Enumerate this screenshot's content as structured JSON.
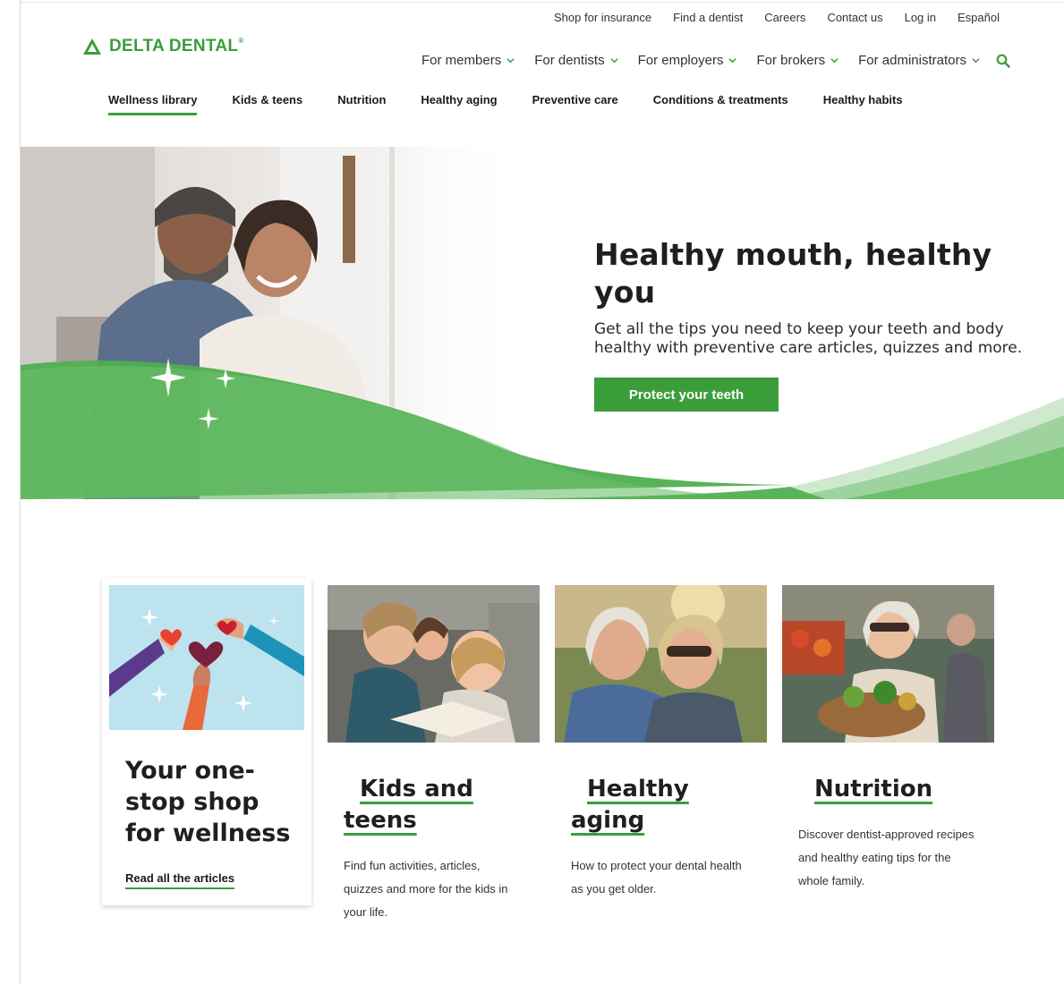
{
  "brand": {
    "name": "DELTA DENTAL",
    "accent": "#3a9d3a",
    "logo_icon": "delta-triangle-icon"
  },
  "utility_nav": [
    "Shop for insurance",
    "Find a dentist",
    "Careers",
    "Contact us",
    "Log in",
    "Español"
  ],
  "main_nav": {
    "items": [
      "For members",
      "For dentists",
      "For employers",
      "For brokers",
      "For administrators"
    ],
    "search_icon": "search-icon"
  },
  "sub_nav": {
    "items": [
      "Wellness library",
      "Kids & teens",
      "Nutrition",
      "Healthy aging",
      "Preventive care",
      "Conditions & treatments",
      "Healthy habits"
    ],
    "active": "Wellness library"
  },
  "hero": {
    "title": "Healthy mouth, healthy you",
    "subtitle": "Get all the tips you need to keep your teeth and body healthy with preventive care articles, quizzes and more.",
    "button": "Protect your teeth"
  },
  "intro_card": {
    "title": "Your one-stop shop for wellness",
    "link": "Read all the articles"
  },
  "topics": [
    {
      "title": "Kids and teens",
      "description": "Find fun activities, articles, quizzes and more for the kids in your life."
    },
    {
      "title": "Healthy aging",
      "description": "How to protect your dental health as you get older."
    },
    {
      "title": "Nutrition",
      "description": "Discover dentist-approved recipes and healthy eating tips for the whole family."
    }
  ]
}
